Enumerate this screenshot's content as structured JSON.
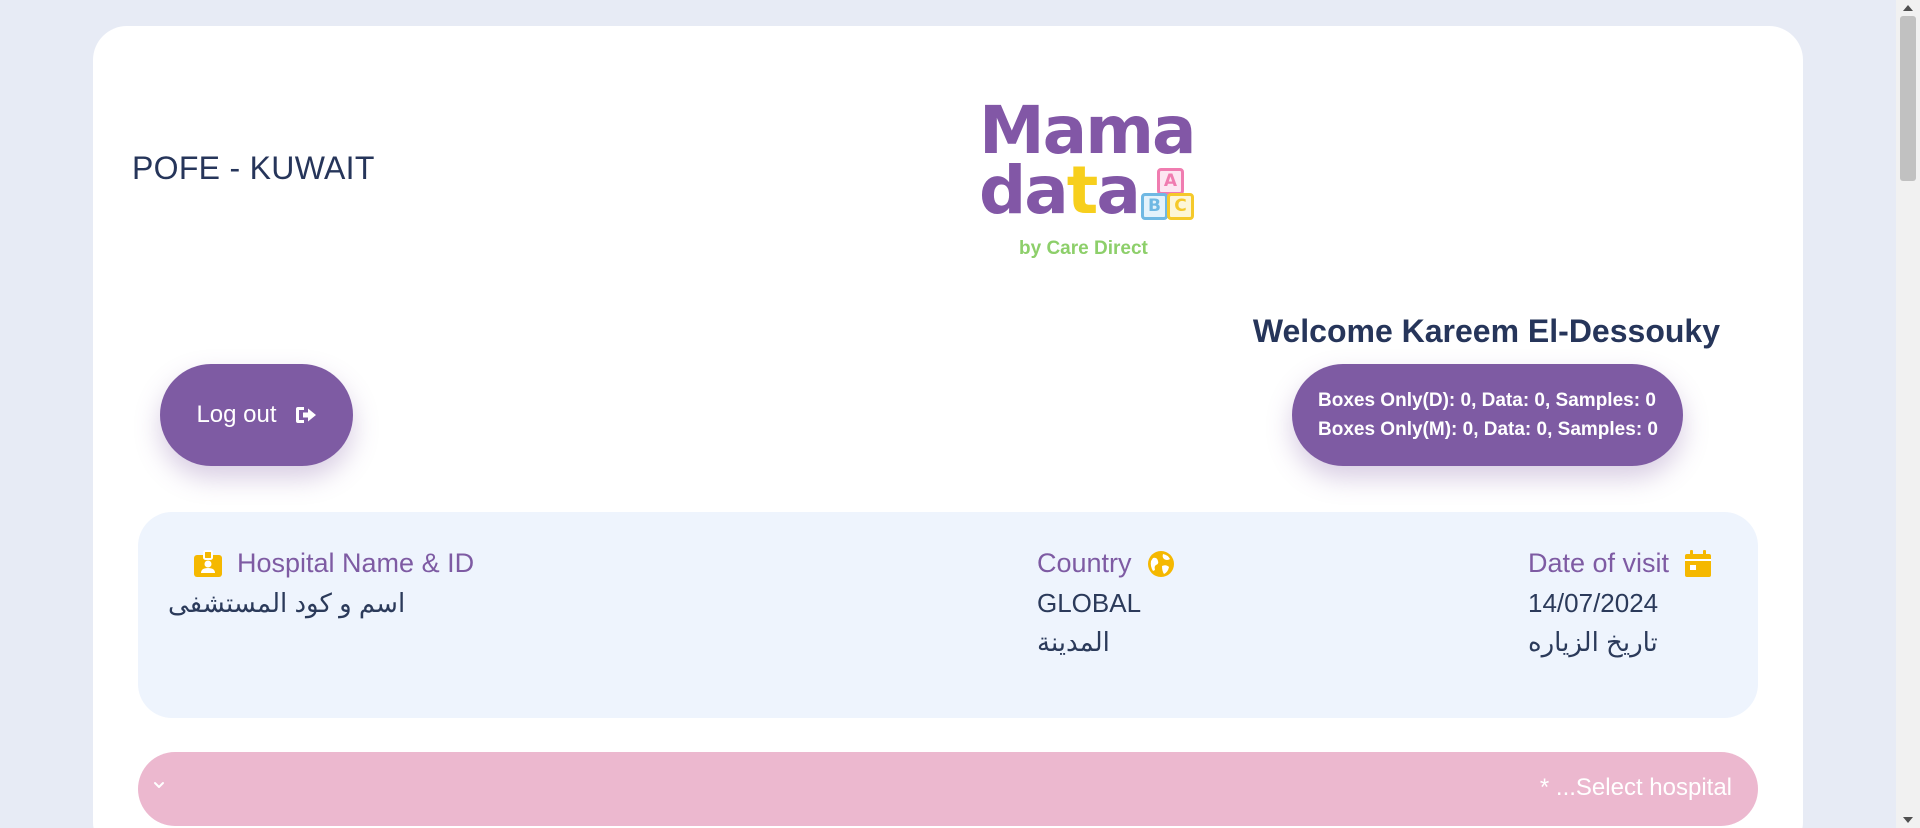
{
  "header": {
    "site_title": "POFE - KUWAIT",
    "logo": {
      "word1": "Mama",
      "word2_a": "da",
      "word2_t": "t",
      "word2_b": "a",
      "blocks": [
        "A",
        "B",
        "C"
      ],
      "byline": "by Care Direct",
      "colors": {
        "purple": "#8257a6",
        "yellow": "#f7cf1d",
        "green": "#8dcf6a"
      }
    },
    "welcome": "Welcome Kareem El-Dessouky"
  },
  "actions": {
    "logout_label": "Log out",
    "logout_icon": "sign-out-icon",
    "stats_line1": "Boxes Only(D): 0, Data: 0, Samples: 0",
    "stats_line2": "Boxes Only(M): 0, Data: 0, Samples: 0"
  },
  "info": {
    "hospital": {
      "label": "Hospital Name & ID",
      "icon": "id-badge-icon",
      "value": "اسم و كود المستشفى"
    },
    "country": {
      "label": "Country",
      "icon": "globe-icon",
      "value": "GLOBAL",
      "sub": "المدينة"
    },
    "date": {
      "label": "Date of visit",
      "icon": "calendar-icon",
      "value": "14/07/2024",
      "sub": "تاريخ الزياره"
    }
  },
  "select": {
    "placeholder": "* ...Select hospital",
    "icon": "chevron-down-icon"
  },
  "theme": {
    "accent": "#7e5ba3",
    "icon_yellow": "#f5b800",
    "panel_bg": "#eef4fd",
    "select_bg": "#ecb8cf"
  }
}
